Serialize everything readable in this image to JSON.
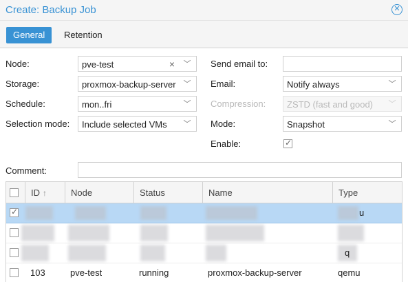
{
  "window": {
    "title": "Create: Backup Job"
  },
  "tabs": [
    {
      "label": "General",
      "active": true
    },
    {
      "label": "Retention",
      "active": false
    }
  ],
  "form": {
    "node": {
      "label": "Node:",
      "value": "pve-test"
    },
    "storage": {
      "label": "Storage:",
      "value": "proxmox-backup-server"
    },
    "schedule": {
      "label": "Schedule:",
      "value": "mon..fri"
    },
    "selection_mode": {
      "label": "Selection mode:",
      "value": "Include selected VMs"
    },
    "send_email": {
      "label": "Send email to:",
      "value": ""
    },
    "email": {
      "label": "Email:",
      "value": "Notify always"
    },
    "compression": {
      "label": "Compression:",
      "value": "ZSTD (fast and good)",
      "disabled": true
    },
    "mode": {
      "label": "Mode:",
      "value": "Snapshot"
    },
    "enable": {
      "label": "Enable:",
      "checked": true
    },
    "comment": {
      "label": "Comment:",
      "value": ""
    }
  },
  "grid": {
    "columns": [
      "ID",
      "Node",
      "Status",
      "Name",
      "Type"
    ],
    "rows": [
      {
        "id": "",
        "node": "",
        "status": "",
        "name": "",
        "type": "u",
        "selected": true,
        "checked": true,
        "redacted": true
      },
      {
        "id": "",
        "node": "",
        "status": "",
        "name": "",
        "type": "",
        "selected": false,
        "checked": false,
        "redacted": true
      },
      {
        "id": "",
        "node": "",
        "status": "",
        "name": "",
        "type": "q",
        "selected": false,
        "checked": false,
        "redacted": true
      },
      {
        "id": "103",
        "node": "pve-test",
        "status": "running",
        "name": "proxmox-backup-server",
        "type": "qemu",
        "selected": false,
        "checked": false,
        "redacted": false
      }
    ]
  },
  "colors": {
    "accent": "#3892d4",
    "selected_row": "#b8d8f5"
  }
}
